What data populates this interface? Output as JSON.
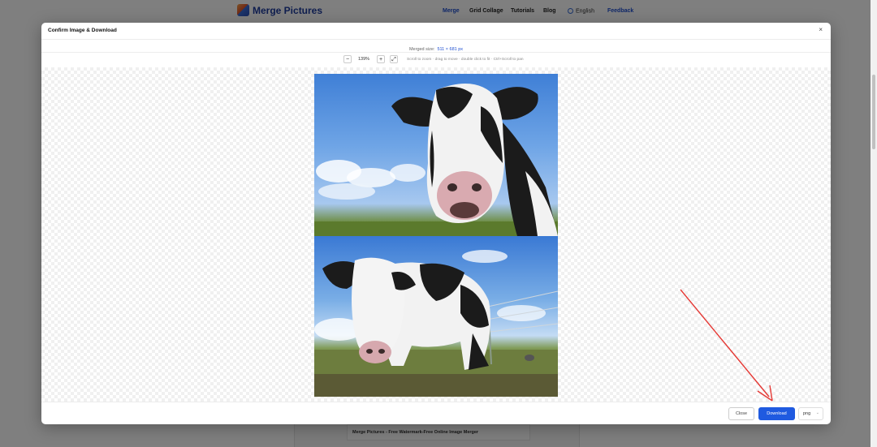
{
  "header": {
    "brand": "Merge Pictures",
    "nav": [
      {
        "label": "Merge"
      },
      {
        "label": "Grid Collage"
      },
      {
        "label": "Tutorials"
      },
      {
        "label": "Blog"
      }
    ],
    "language": "English",
    "feedback": "Feedback"
  },
  "page": {
    "card_title": "Merge Pictures - Free Watermark-Free Online Image Merger"
  },
  "modal": {
    "title": "Confirm Image & Download",
    "close_icon": "×",
    "merged_size_label": "Merged size:",
    "merged_size_value": "511 × 681 px",
    "zoom_out": "−",
    "zoom_level": "139%",
    "zoom_in": "+",
    "fit": "⤢",
    "hint": "Scroll to zoom · drag to move · double click to fit · Ctrl+Scroll to pan",
    "close_button": "Close",
    "download_button": "Download",
    "format": "png",
    "format_chevron": "⌄"
  },
  "colors": {
    "accent": "#1f5ae0",
    "brand": "#1f3c9e",
    "annotation_arrow": "#e53935"
  },
  "icons": [
    "logo-icon",
    "globe-icon",
    "close-icon",
    "zoom-out-icon",
    "zoom-in-icon",
    "fit-icon",
    "chevron-down-icon",
    "arrow-annotation-icon"
  ]
}
